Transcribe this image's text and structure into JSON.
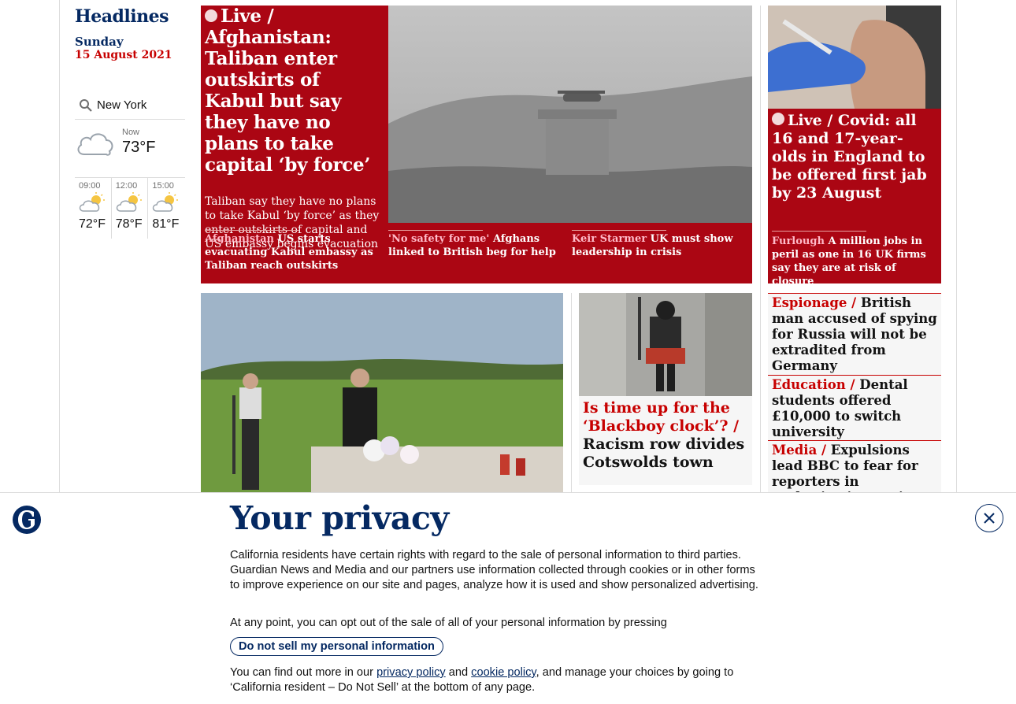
{
  "sidebar": {
    "section_title": "Headlines",
    "day": "Sunday",
    "date": "15 August 2021",
    "weather": {
      "location": "New York",
      "now_label": "Now",
      "now_temp": "73°F",
      "forecast": [
        {
          "time": "09:00",
          "temp": "72°F"
        },
        {
          "time": "12:00",
          "temp": "78°F"
        },
        {
          "time": "15:00",
          "temp": "81°F"
        }
      ]
    }
  },
  "top_story": {
    "kicker": "Live /",
    "headline": "Afghanistan: Taliban enter outskirts of Kabul but say they have no plans to take capital ‘by force’",
    "standfirst": "Taliban say they have no plans to take Kabul ‘by force’ as they enter outskirts of capital and US embassy begins evacuation",
    "sublinks": [
      {
        "kicker": "Afghanistan",
        "text": "US starts evacuating Kabul embassy as Taliban reach outskirts"
      },
      {
        "kicker": "'No safety for me'",
        "text": "Afghans linked to British beg for help"
      },
      {
        "kicker": "Keir Starmer",
        "text": "UK must show leadership in crisis"
      }
    ]
  },
  "covid_story": {
    "kicker": "Live /",
    "headline": "Covid: all 16 and 17-year-olds in England to be offered first jab by 23 August",
    "sublink": {
      "kicker": "Furlough",
      "text": "A million jobs in peril as one in 16 UK firms say they are at risk of closure"
    }
  },
  "side_cards": [
    {
      "kicker": "Espionage /",
      "text": "British man accused of spying for Russia will not be extradited from Germany"
    },
    {
      "kicker": "Education /",
      "text": "Dental students offered £10,000 to switch university"
    },
    {
      "kicker": "Media /",
      "text": "Expulsions lead BBC to fear for reporters in authoritarian regimes"
    }
  ],
  "blackboy_story": {
    "kicker": "Is time up for the ‘Blackboy clock’? /",
    "text": "Racism row divides Cotswolds town"
  },
  "privacy": {
    "title": "Your privacy",
    "body1": "California residents have certain rights with regard to the sale of personal information to third parties. Guardian News and Media and our partners use information collected through cookies or in other forms to improve experience on our site and pages, analyze how it is used and show personalized advertising.",
    "body2": "At any point, you can opt out of the sale of all of your personal information by pressing",
    "button": "Do not sell my personal information",
    "body3_pre": "You can find out more in our",
    "privacy_link": "privacy policy",
    "and": "and",
    "cookie_link": "cookie policy",
    "body3_post": ", and manage your choices by going to ‘California resident – Do Not Sell’ at the bottom of any page."
  },
  "colors": {
    "brand_navy": "#052962",
    "news_red": "#c70000",
    "live_red": "#ab0613"
  }
}
